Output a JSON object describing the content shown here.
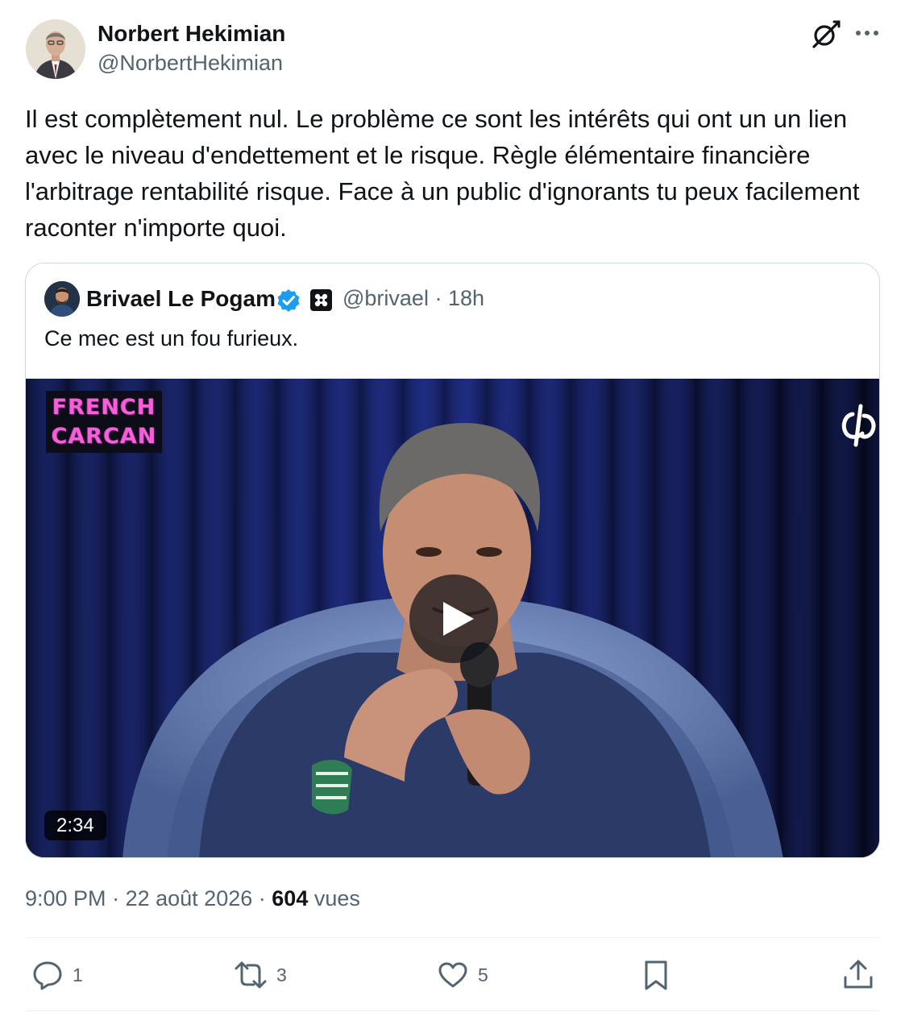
{
  "tweet": {
    "author_name": "Norbert Hekimian",
    "author_handle": "@NorbertHekimian",
    "text": "Il est complètement nul. Le problème ce sont les intérêts qui ont un un lien avec le niveau d'endettement et le risque. Règle élémentaire financière l'arbitrage rentabilité risque. Face à un public d'ignorants tu peux facilement raconter n'importe quoi.",
    "time": "9:00 PM",
    "date": "22 août 2026",
    "separator": "·",
    "views_count": "604",
    "views_label": "vues"
  },
  "quote": {
    "author_name": "Brivael Le Pogam",
    "handle": "@brivael",
    "time_ago": "18h",
    "separator": "·",
    "text": "Ce mec est un fou furieux.",
    "video": {
      "logo_line1": "FRENCH",
      "logo_line2": "CARCAN",
      "duration": "2:34"
    }
  },
  "actions": {
    "reply_count": "1",
    "retweet_count": "3",
    "like_count": "5"
  },
  "colors": {
    "text": "#0f1419",
    "secondary": "#536471",
    "verified": "#1d9bf0",
    "border": "#cfd9de",
    "logo_pink": "#f65fd8"
  },
  "icons": [
    "grok-icon",
    "more-icon",
    "verified-badge-icon",
    "affiliate-badge-icon",
    "play-icon",
    "reply-icon",
    "retweet-icon",
    "like-icon",
    "bookmark-icon",
    "share-icon"
  ]
}
